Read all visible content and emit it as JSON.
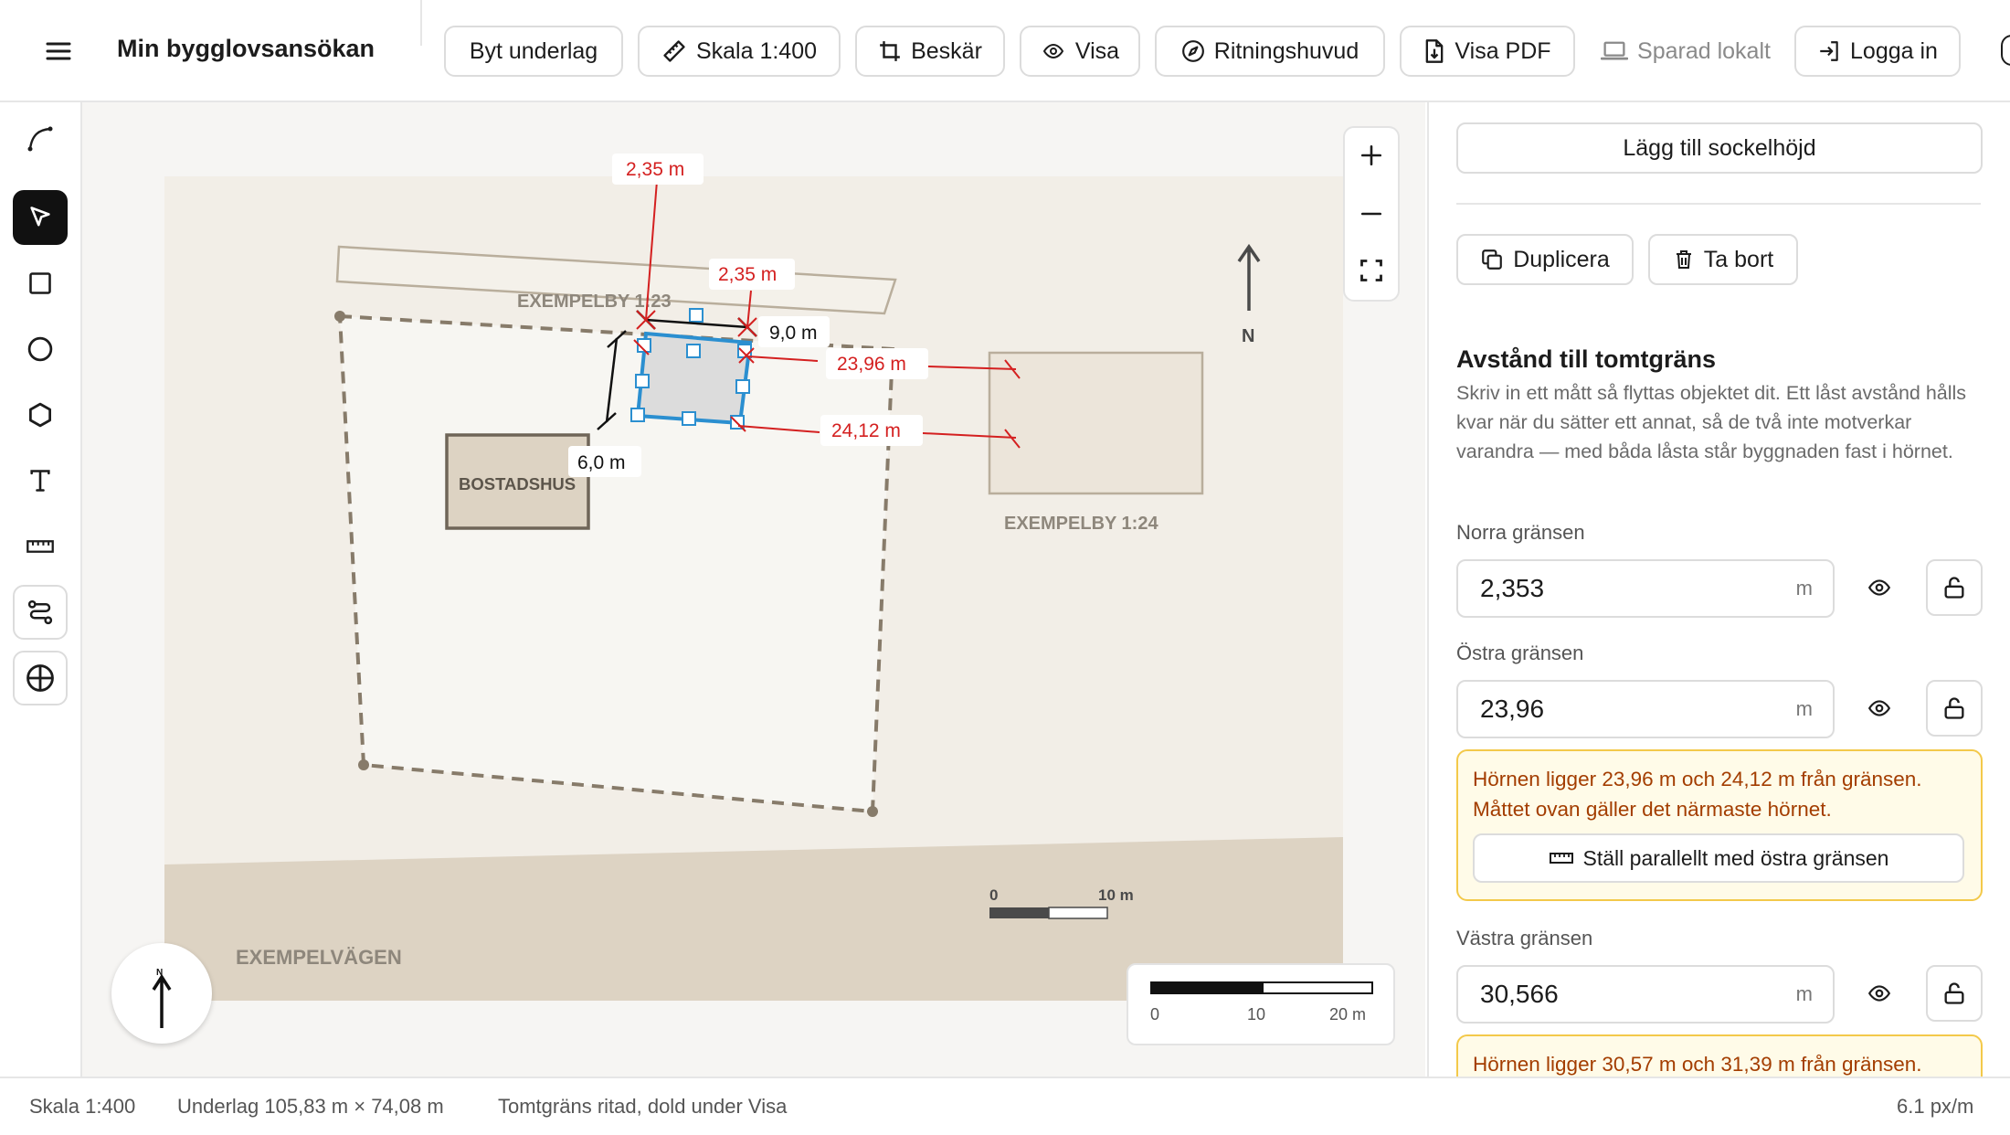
{
  "header": {
    "title": "Min bygglovsansökan",
    "buttons": {
      "change_base": "Byt underlag",
      "scale": "Skala 1:400",
      "crop": "Beskär",
      "show": "Visa",
      "drawing_header": "Ritningshuvud",
      "show_pdf": "Visa PDF",
      "saved_local": "Sparad lokalt",
      "login": "Logga in"
    }
  },
  "toolbar": {
    "tools": [
      "curve-tool",
      "select-tool",
      "rectangle-tool",
      "circle-tool",
      "polygon-tool",
      "text-tool",
      "measure-tool",
      "path-tool",
      "crosshair-tool"
    ],
    "active": "select-tool"
  },
  "map": {
    "labels": {
      "neighbor_north": "EXEMPELBY 1:23",
      "neighbor_east": "EXEMPELBY 1:24",
      "house": "BOSTADSHUS",
      "road": "EXEMPELVÄGEN",
      "north": "N",
      "compass_n": "N"
    },
    "dimensions": {
      "north_a": "2,35 m",
      "north_b": "2,35 m",
      "width": "9,0 m",
      "depth": "6,0 m",
      "east_a": "23,96 m",
      "east_b": "24,12 m"
    },
    "inner_scale": {
      "start": "0",
      "end": "10 m"
    },
    "scale_bar": {
      "l0": "0",
      "l1": "10",
      "l2": "20 m"
    }
  },
  "panel": {
    "add_base_height": "Lägg till sockelhöjd",
    "duplicate": "Duplicera",
    "delete": "Ta bort",
    "section_title": "Avstånd till tomtgräns",
    "section_desc": "Skriv in ett mått så flyttas objektet dit. Ett låst avstånd hålls kvar när du sätter ett annat, så de två inte motverkar varandra — med båda låsta står byggnaden fast i hörnet.",
    "north": {
      "label": "Norra gränsen",
      "value": "2,353",
      "unit": "m"
    },
    "east": {
      "label": "Östra gränsen",
      "value": "23,96",
      "unit": "m",
      "warning": "Hörnen ligger 23,96 m och 24,12 m från gränsen. Måttet ovan gäller det närmaste hörnet.",
      "parallel_btn": "Ställ parallellt med östra gränsen"
    },
    "west": {
      "label": "Västra gränsen",
      "value": "30,566",
      "unit": "m",
      "warning": "Hörnen ligger 30,57 m och 31,39 m från gränsen."
    }
  },
  "status": {
    "scale": "Skala 1:400",
    "base": "Underlag 105,83 m × 74,08 m",
    "boundary": "Tomtgräns ritad, dold under Visa",
    "resolution": "6.1 px/m"
  },
  "colors": {
    "dimension_red": "#d42020",
    "selection_blue": "#2b8fd0",
    "warning_bg": "#fffbe8",
    "warning_border": "#f3c94a",
    "warning_text": "#a33d00"
  }
}
